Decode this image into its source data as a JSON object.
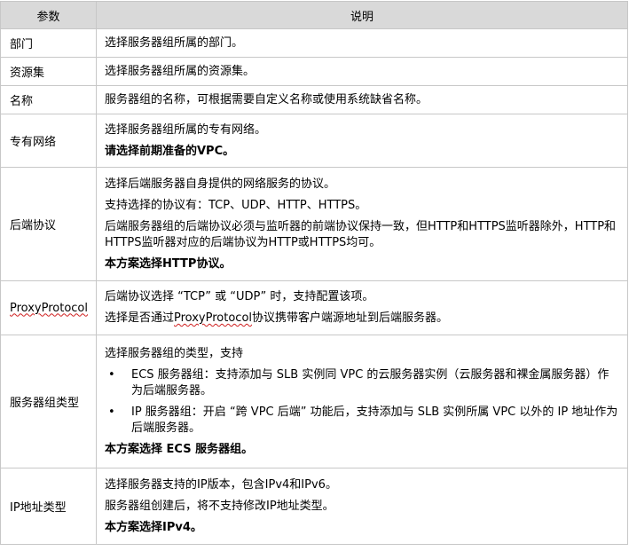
{
  "header": {
    "param": "参数",
    "desc": "说明"
  },
  "rows": [
    {
      "param": "部门",
      "desc": [
        "选择服务器组所属的部门。"
      ]
    },
    {
      "param": "资源集",
      "desc": [
        "选择服务器组所属的资源集。"
      ]
    },
    {
      "param": "名称",
      "desc": [
        "服务器组的名称，可根据需要自定义名称或使用系统缺省名称。"
      ]
    },
    {
      "param": "专有网络",
      "desc": [
        "选择服务器组所属的专有网络。"
      ],
      "bold": "请选择前期准备的VPC。"
    },
    {
      "param": "后端协议",
      "desc": [
        "选择后端服务器自身提供的网络服务的协议。",
        "支持选择的协议有：TCP、UDP、HTTP、HTTPS。",
        "后端服务器组的后端协议必须与监听器的前端协议保持一致，但HTTP和HTTPS监听器除外，HTTP和HTTPS监听器对应的后端协议为HTTP或HTTPS均可。"
      ],
      "bold": "本方案选择HTTP协议。"
    },
    {
      "param": "ProxyProtocol",
      "desc": [
        "后端协议选择 “TCP” 或 “UDP” 时，支持配置该项。"
      ],
      "desc2_pre": "选择是否通过",
      "desc2_mark": "ProxyProtocol",
      "desc2_post": "协议携带客户端源地址到后端服务器。"
    },
    {
      "param": "服务器组类型",
      "desc": [
        "选择服务器组的类型，支持"
      ],
      "bullets": [
        "ECS 服务器组：支持添加与 SLB 实例同 VPC 的云服务器实例（云服务器和裸金属服务器）作为后端服务器。",
        "IP 服务器组：开启 “跨 VPC 后端” 功能后，支持添加与 SLB 实例所属 VPC 以外的 IP 地址作为后端服务器。"
      ],
      "bullet_glyph": "•",
      "bold": "本方案选择 ECS 服务器组。"
    },
    {
      "param": "IP地址类型",
      "desc": [
        "选择服务器支持的IP版本，包含IPv4和IPv6。",
        "服务器组创建后，将不支持修改IP地址类型。"
      ],
      "bold": "本方案选择IPv4。"
    }
  ]
}
